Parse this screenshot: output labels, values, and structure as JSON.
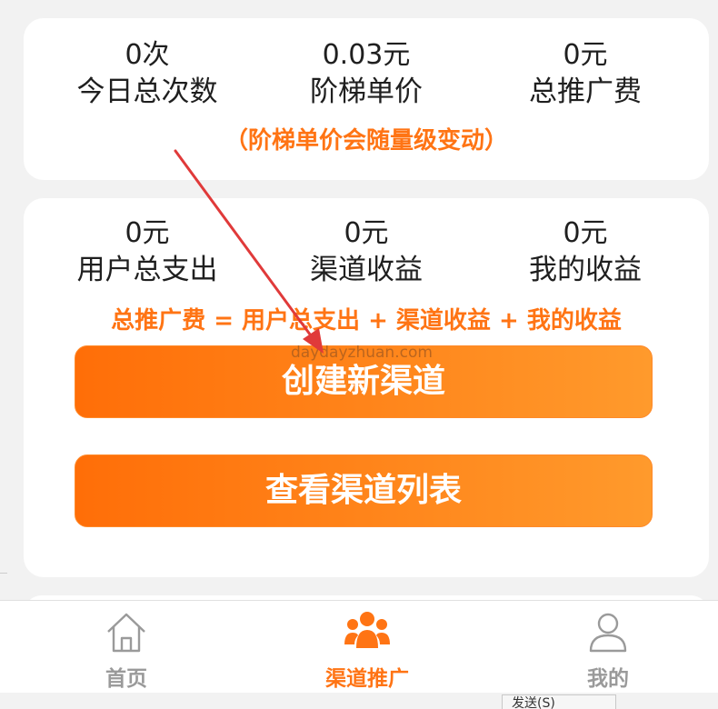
{
  "stats_top": [
    {
      "value": "0次",
      "label": "今日总次数"
    },
    {
      "value": "0.03元",
      "label": "阶梯单价"
    },
    {
      "value": "0元",
      "label": "总推广费"
    }
  ],
  "top_note": "（阶梯单价会随量级变动）",
  "stats_mid": [
    {
      "value": "0元",
      "label": "用户总支出"
    },
    {
      "value": "0元",
      "label": "渠道收益"
    },
    {
      "value": "0元",
      "label": "我的收益"
    }
  ],
  "formula_note": "总推广费 = 用户总支出 + 渠道收益 + 我的收益",
  "watermark": "daydayzhuan.com",
  "buttons": {
    "create": "创建新渠道",
    "view_list": "查看渠道列表"
  },
  "tabs": [
    {
      "label": "首页",
      "icon": "home-icon",
      "active": false
    },
    {
      "label": "渠道推广",
      "icon": "group-icon",
      "active": true
    },
    {
      "label": "我的",
      "icon": "person-icon",
      "active": false
    }
  ],
  "send_button": "发送(S)",
  "colors": {
    "accent": "#ff7414",
    "button_start": "#ff6e08",
    "button_end": "#ff9a2c",
    "inactive_tab": "#9a9a9a",
    "arrow": "#e03a3a"
  }
}
